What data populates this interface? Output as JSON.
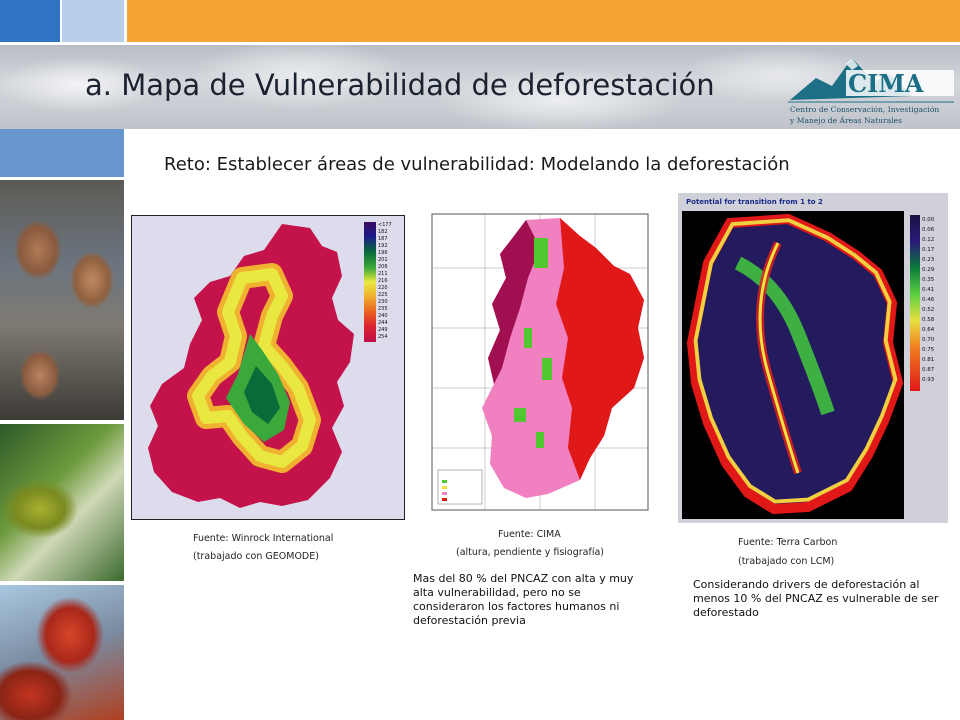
{
  "title": "a.  Mapa de Vulnerabilidad de deforestación",
  "subtitle": "Reto: Establecer áreas de vulnerabilidad: Modelando la deforestación",
  "logo": {
    "name": "CIMA",
    "tagline_line1": "Centro de Conservación, Investigación",
    "tagline_line2": "y Manejo de Áreas Naturales"
  },
  "map1": {
    "legend": [
      "<177",
      "182",
      "187",
      "192",
      "196",
      "201",
      "206",
      "211",
      "216",
      "220",
      "225",
      "230",
      "235",
      "240",
      "244",
      "249",
      "254"
    ],
    "source": "Fuente: Winrock International",
    "detail": "(trabajado con GEOMODE)"
  },
  "map2": {
    "source": "Fuente: CIMA",
    "detail": "(altura, pendiente y fisiografía)",
    "note": "Mas del 80 % del PNCAZ con alta y muy alta vulnerabilidad, pero no se consideraron los factores humanos ni deforestación previa"
  },
  "map3": {
    "title": "Potential for transition from 1 to 2",
    "legend": [
      "0.00",
      "0.06",
      "0.12",
      "0.17",
      "0.23",
      "0.29",
      "0.35",
      "0.41",
      "0.46",
      "0.52",
      "0.58",
      "0.64",
      "0.70",
      "0.75",
      "0.81",
      "0.87",
      "0.93"
    ],
    "source": "Fuente: Terra Carbon",
    "detail": "(trabajado con LCM)",
    "note": "Considerando drivers de deforestación al menos 10 % del PNCAZ es vulnerable de ser deforestado"
  },
  "colors": {
    "top_blue": "#2e74c2",
    "top_orange": "#f4a433",
    "strip_blue": "#6796cf",
    "logo_teal": "#1d6f86"
  }
}
